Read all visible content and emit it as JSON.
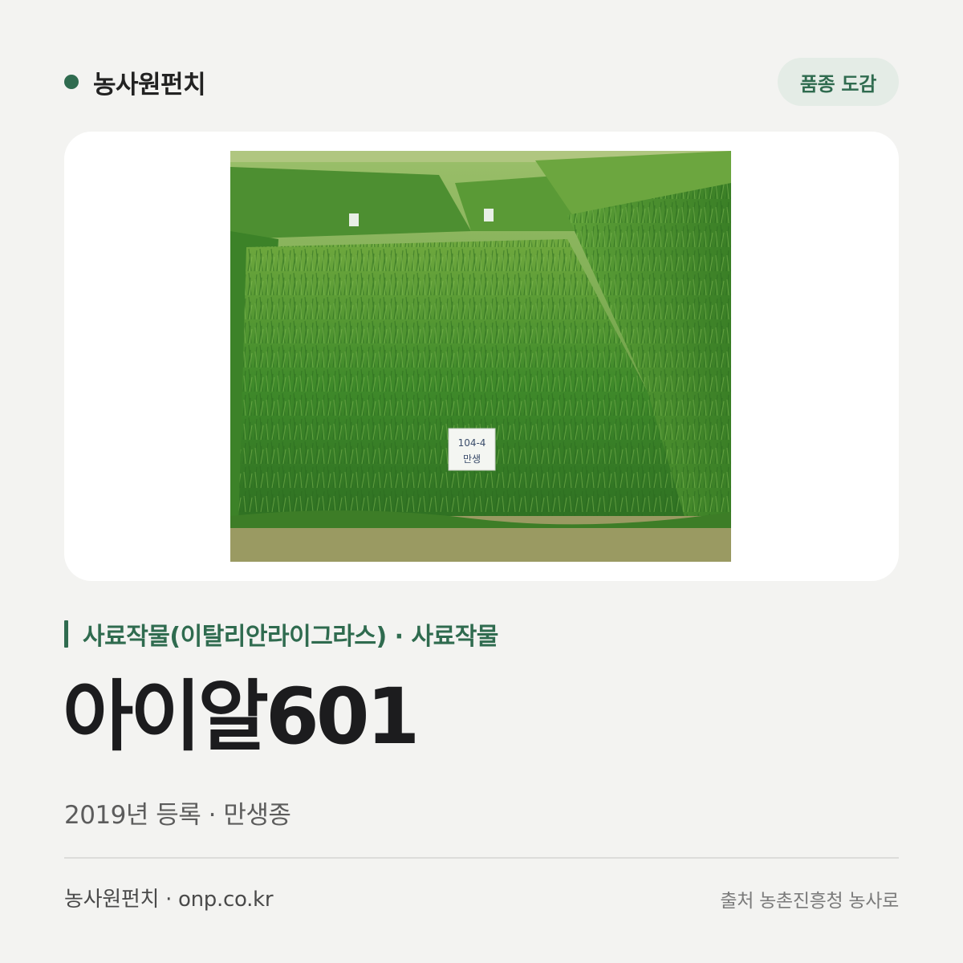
{
  "header": {
    "brand": "농사원펀치",
    "tag": "품종 도감"
  },
  "image": {
    "alt": "이탈리안라이그라스 포장 사진",
    "plot_label_line1": "104-4",
    "plot_label_line2": "만생"
  },
  "variety": {
    "category": "사료작물(이탈리안라이그라스) · 사료작물",
    "name": "아이알601",
    "meta": "2019년 등록 · 만생종"
  },
  "footer": {
    "site": "농사원펀치 · onp.co.kr",
    "source": "출처 농촌진흥청 농사로"
  },
  "colors": {
    "accent": "#2f6b4f",
    "tag_bg": "#e4ece6",
    "background": "#f3f3f1"
  }
}
